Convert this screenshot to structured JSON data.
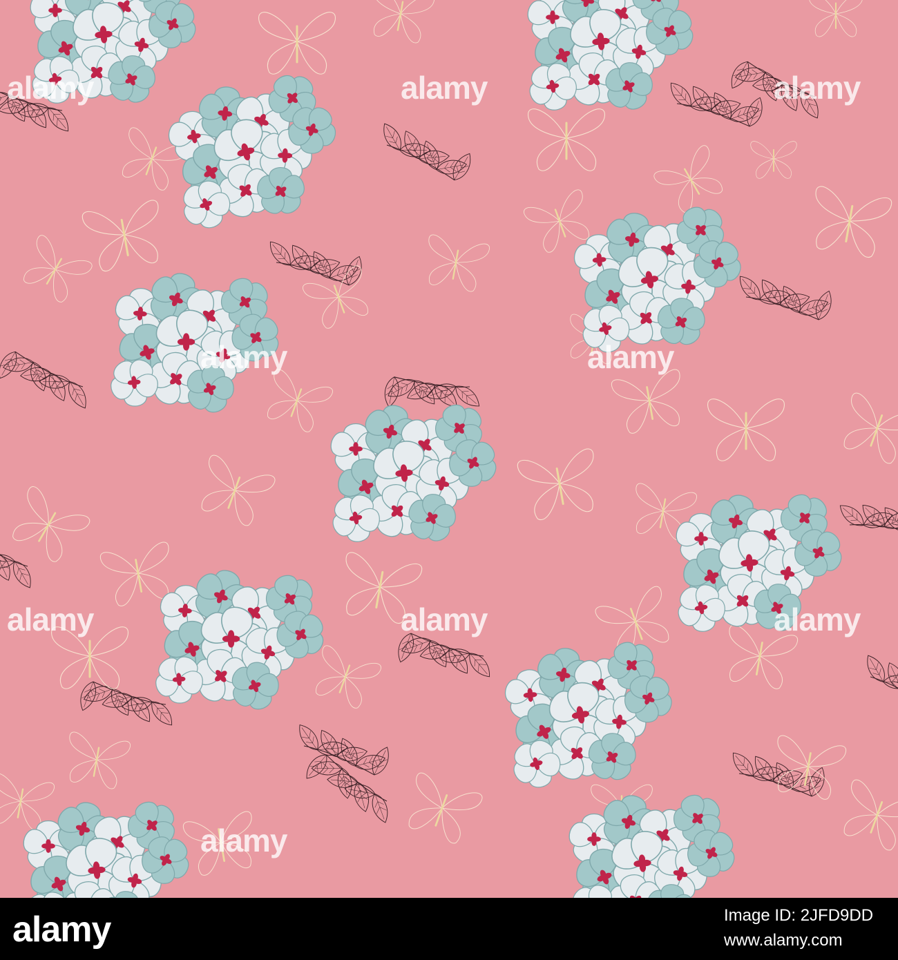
{
  "watermark": {
    "text": "alamy"
  },
  "footer": {
    "logo_text": "alamy",
    "image_id": "Image ID: 2JFD9DD",
    "url": "www.alamy.com"
  },
  "colors": {
    "background": "#e99aa2",
    "petal_white": "#e7ecef",
    "petal_blue": "#a2c8c9",
    "flower_center": "#c0244a",
    "petal_outline": "#7fa8ab",
    "leaf_outline": "#3e2328",
    "butterfly_outline": "#f8e2cf",
    "butterfly_body": "#ecd8a0",
    "footer_bg": "#000000",
    "footer_text": "#ffffff"
  },
  "pattern": {
    "motifs": [
      "flower-cluster",
      "leaf-sprig",
      "butterfly-outline"
    ]
  }
}
